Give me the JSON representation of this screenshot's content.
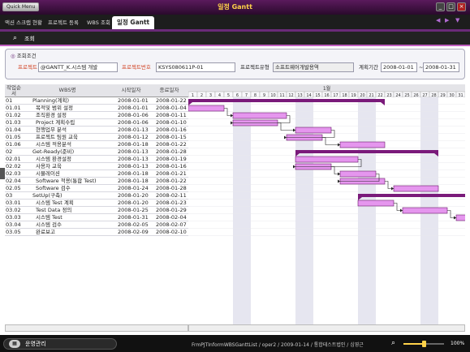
{
  "window": {
    "title": "일정 Gantt",
    "quick_menu": "Quick Menu"
  },
  "tabs": [
    {
      "label": "액션 스크랩 현황"
    },
    {
      "label": "프로젝트 등록"
    },
    {
      "label": "WBS 조회"
    },
    {
      "label": "일정 Gantt",
      "active": true
    }
  ],
  "header": {
    "title": "조회",
    "icon": "search-icon"
  },
  "conditions": {
    "title": "조회조건",
    "project_label": "프로젝트",
    "project_value": "@GANTT_K.시스템 개발",
    "project_no_label": "프로젝트번호",
    "project_no_value": "KSYS080611P-01",
    "project_type_label": "프로젝트유형",
    "project_type_value": "소프트웨어개발용역",
    "period_label": "계획기간",
    "period_from": "2008-01-01",
    "period_sep": "~",
    "period_to": "2008-01-31"
  },
  "grid": {
    "columns": [
      "작업순서",
      "WBS명",
      "시작일자",
      "종료일자"
    ],
    "rows": [
      {
        "seq": "01",
        "name": "Planning(계획)",
        "start": "2008-01-01",
        "end": "2008-01-22",
        "level": 0
      },
      {
        "seq": "01.01",
        "name": "목적및 범위 설정",
        "start": "2008-01-01",
        "end": "2008-01-04",
        "level": 1
      },
      {
        "seq": "01.02",
        "name": "조직환경 설정",
        "start": "2008-01-06",
        "end": "2008-01-11",
        "level": 1
      },
      {
        "seq": "01.03",
        "name": "Project 계획수립",
        "start": "2008-01-06",
        "end": "2008-01-10",
        "level": 1
      },
      {
        "seq": "01.04",
        "name": "현행업무 분석",
        "start": "2008-01-13",
        "end": "2008-01-16",
        "level": 1
      },
      {
        "seq": "01.05",
        "name": "프로젝트 팀원 교육",
        "start": "2008-01-12",
        "end": "2008-01-15",
        "level": 1
      },
      {
        "seq": "01.06",
        "name": "시스템 적용분석",
        "start": "2008-01-18",
        "end": "2008-01-22",
        "level": 1
      },
      {
        "seq": "02",
        "name": "Get-Ready(준비)",
        "start": "2008-01-13",
        "end": "2008-01-28",
        "level": 0
      },
      {
        "seq": "02.01",
        "name": "시스템 환경설정",
        "start": "2008-01-13",
        "end": "2008-01-19",
        "level": 1
      },
      {
        "seq": "02.02",
        "name": "사용자 교육",
        "start": "2008-01-13",
        "end": "2008-01-16",
        "level": 1
      },
      {
        "seq": "02.03",
        "name": "시뮬레이션",
        "start": "2008-01-18",
        "end": "2008-01-21",
        "level": 1
      },
      {
        "seq": "02.04",
        "name": "Software 적용(통합 Test)",
        "start": "2008-01-18",
        "end": "2008-01-22",
        "level": 1
      },
      {
        "seq": "02.05",
        "name": "Software 검수",
        "start": "2008-01-24",
        "end": "2008-01-28",
        "level": 1
      },
      {
        "seq": "03",
        "name": "SetUp(구축)",
        "start": "2008-01-20",
        "end": "2008-02-11",
        "level": 0
      },
      {
        "seq": "03.01",
        "name": "시스템 Test 계획",
        "start": "2008-01-20",
        "end": "2008-01-23",
        "level": 1
      },
      {
        "seq": "03.02",
        "name": "Test Data 정의",
        "start": "2008-01-25",
        "end": "2008-01-29",
        "level": 1
      },
      {
        "seq": "03.03",
        "name": "시스템 Test",
        "start": "2008-01-31",
        "end": "2008-02-04",
        "level": 1
      },
      {
        "seq": "03.04",
        "name": "시스템 검수",
        "start": "2008-02-05",
        "end": "2008-02-07",
        "level": 1
      },
      {
        "seq": "03.05",
        "name": "완료보고",
        "start": "2008-02-09",
        "end": "2008-02-10",
        "level": 1
      }
    ]
  },
  "chart": {
    "month_label": "1월",
    "days": [
      "1",
      "2",
      "3",
      "4",
      "5",
      "6",
      "7",
      "8",
      "9",
      "10",
      "11",
      "12",
      "13",
      "14",
      "15",
      "16",
      "17",
      "18",
      "19",
      "20",
      "21",
      "22",
      "23",
      "24",
      "25",
      "26",
      "27",
      "28",
      "29",
      "30",
      "31"
    ],
    "weekend_days": [
      5,
      6,
      12,
      13,
      19,
      20,
      26,
      27
    ],
    "colors": {
      "task": "#e596ee",
      "summary": "#7a1a7a",
      "weekend": "#e6e6f0",
      "link": "#222222"
    }
  },
  "status": {
    "menu_label": "운영관리",
    "menu_icon": "grid-icon",
    "text": "FrmPJTInformWBSGanttList / oper2 / 2009-01-14 / 통합테스트법인 / 심영근",
    "zoom": "100%",
    "zoom_fraction": 0.5
  }
}
